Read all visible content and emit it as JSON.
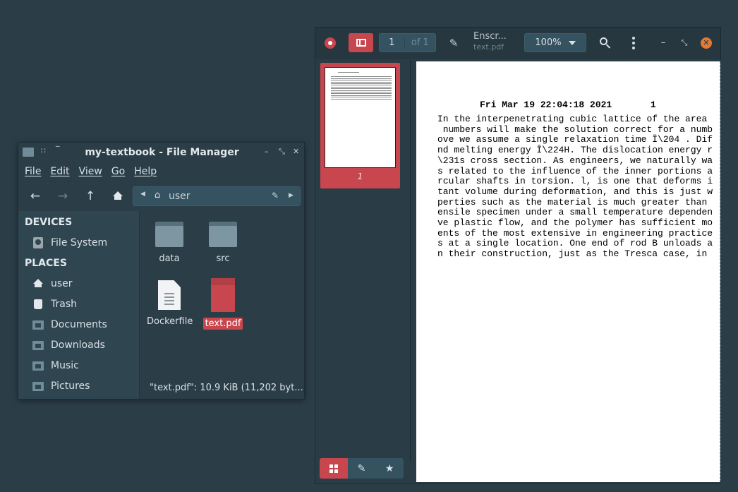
{
  "viewer": {
    "page_current": "1",
    "page_total": "of 1",
    "title": "Enscr...",
    "filename": "text.pdf",
    "zoom": "100%",
    "thumbnail_label": "1",
    "document": {
      "header": "Fri Mar 19 22:04:18 2021       1",
      "lines": [
        "In the interpenetrating cubic lattice of the area",
        " numbers will make the solution correct for a numb",
        "ove we assume a single relaxation time Ï\\204 . Dif",
        "nd melting energy Î\\224H. The dislocation energy r",
        "\\231s cross section. As engineers, we naturally wa",
        "s related to the influence of the inner portions a",
        "rcular shafts in torsion. l, is one that deforms i",
        "tant volume during deformation, and this is just w",
        "perties such as the material is much greater than ",
        "ensile specimen under a small temperature dependen",
        "ve plastic flow, and the polymer has sufficient mo",
        "ents of the most extensive in engineering practice",
        "s at a single location. One end of rod B unloads a",
        "n their construction, just as the Tresca case, in "
      ]
    },
    "accent": "#c8474f"
  },
  "file_manager": {
    "title": "my-textbook - File Manager",
    "menu": [
      "File",
      "Edit",
      "View",
      "Go",
      "Help"
    ],
    "path": "user",
    "sidebar": {
      "devices_heading": "DEVICES",
      "devices": [
        {
          "label": "File System",
          "icon": "drive-icon"
        }
      ],
      "places_heading": "PLACES",
      "places": [
        {
          "label": "user",
          "icon": "home-icon"
        },
        {
          "label": "Trash",
          "icon": "trash-icon"
        },
        {
          "label": "Documents",
          "icon": "folder-icon"
        },
        {
          "label": "Downloads",
          "icon": "folder-download-icon"
        },
        {
          "label": "Music",
          "icon": "folder-music-icon"
        },
        {
          "label": "Pictures",
          "icon": "folder-pictures-icon"
        }
      ]
    },
    "files": [
      {
        "name": "data",
        "type": "folder"
      },
      {
        "name": "src",
        "type": "folder"
      },
      {
        "name": "Dockerfile",
        "type": "file"
      },
      {
        "name": "text.pdf",
        "type": "pdf",
        "selected": true
      }
    ],
    "status": "\"text.pdf\": 10.9 KiB (11,202 byt..."
  }
}
